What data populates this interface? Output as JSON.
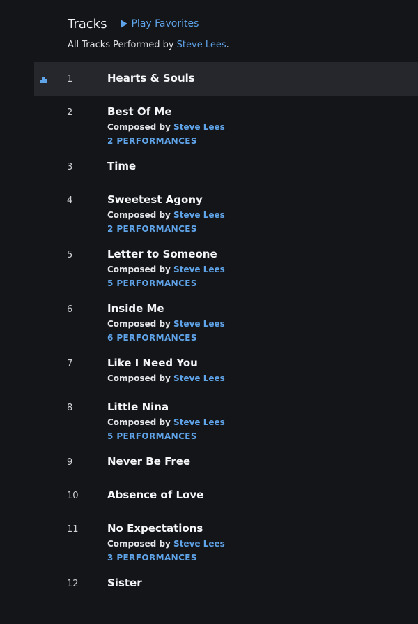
{
  "header": {
    "title": "Tracks",
    "play_favorites": "Play Favorites",
    "subtitle_prefix": "All Tracks Performed by",
    "artist": "Steve Lees",
    "subtitle_suffix": "."
  },
  "composed_by_label": "Composed by",
  "tracks": [
    {
      "number": "1",
      "title": "Hearts & Souls",
      "playing": true
    },
    {
      "number": "2",
      "title": "Best Of Me",
      "composer": "Steve Lees",
      "performances": "2 PERFORMANCES"
    },
    {
      "number": "3",
      "title": "Time"
    },
    {
      "number": "4",
      "title": "Sweetest Agony",
      "composer": "Steve Lees",
      "performances": "2 PERFORMANCES"
    },
    {
      "number": "5",
      "title": "Letter to Someone",
      "composer": "Steve Lees",
      "performances": "5 PERFORMANCES"
    },
    {
      "number": "6",
      "title": "Inside Me",
      "composer": "Steve Lees",
      "performances": "6 PERFORMANCES"
    },
    {
      "number": "7",
      "title": "Like I Need You",
      "composer": "Steve Lees"
    },
    {
      "number": "8",
      "title": "Little Nina",
      "composer": "Steve Lees",
      "performances": "5 PERFORMANCES"
    },
    {
      "number": "9",
      "title": "Never Be Free"
    },
    {
      "number": "10",
      "title": "Absence of Love"
    },
    {
      "number": "11",
      "title": "No Expectations",
      "composer": "Steve Lees",
      "performances": "3 PERFORMANCES"
    },
    {
      "number": "12",
      "title": "Sister"
    }
  ],
  "colors": {
    "background": "#141519",
    "active_row": "#25272c",
    "accent": "#5fa3e8"
  },
  "icons": {
    "playing_indicator": "equalizer-icon",
    "play": "play-icon"
  }
}
